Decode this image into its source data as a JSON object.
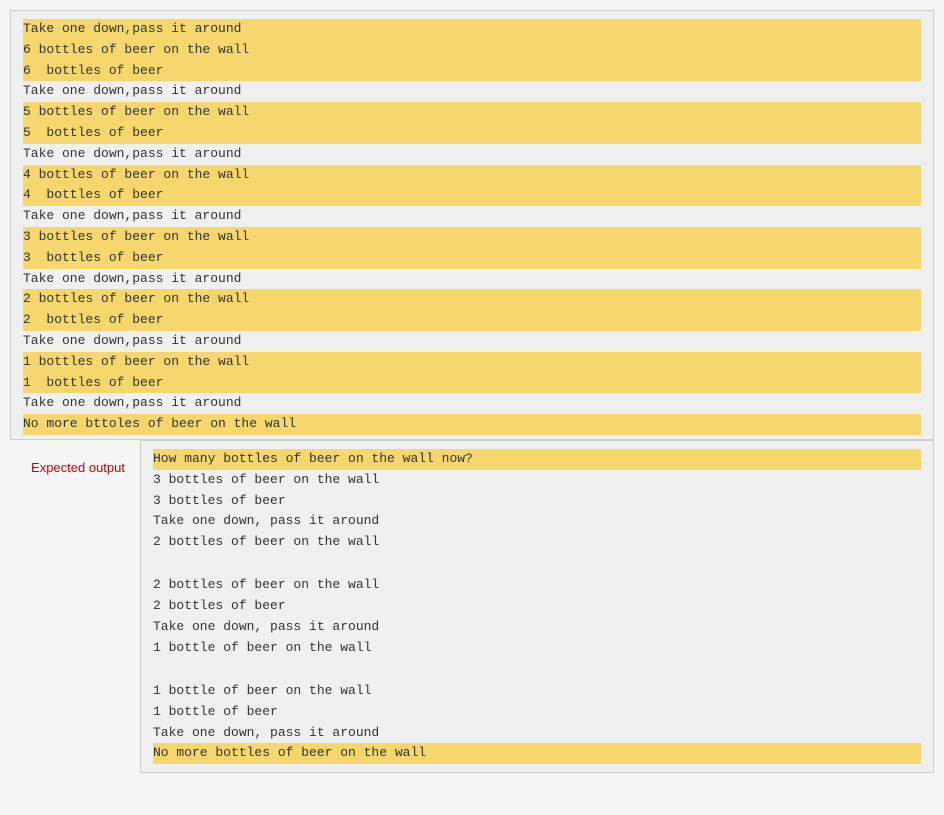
{
  "top_panel": {
    "lines": [
      {
        "text": "Take one down,pass it around",
        "highlight": true
      },
      {
        "text": "6 bottles of beer on the wall",
        "highlight": true
      },
      {
        "text": "6  bottles of beer",
        "highlight": true
      },
      {
        "text": "Take one down,pass it around",
        "highlight": false
      },
      {
        "text": "5 bottles of beer on the wall",
        "highlight": true
      },
      {
        "text": "5  bottles of beer",
        "highlight": true
      },
      {
        "text": "Take one down,pass it around",
        "highlight": false
      },
      {
        "text": "4 bottles of beer on the wall",
        "highlight": true
      },
      {
        "text": "4  bottles of beer",
        "highlight": true
      },
      {
        "text": "Take one down,pass it around",
        "highlight": false
      },
      {
        "text": "3 bottles of beer on the wall",
        "highlight": true
      },
      {
        "text": "3  bottles of beer",
        "highlight": true
      },
      {
        "text": "Take one down,pass it around",
        "highlight": false
      },
      {
        "text": "2 bottles of beer on the wall",
        "highlight": true
      },
      {
        "text": "2  bottles of beer",
        "highlight": true
      },
      {
        "text": "Take one down,pass it around",
        "highlight": false
      },
      {
        "text": "1 bottles of beer on the wall",
        "highlight": true
      },
      {
        "text": "1  bottles of beer",
        "highlight": true
      },
      {
        "text": "Take one down,pass it around",
        "highlight": false
      },
      {
        "text": "No more bttoles of beer on the wall",
        "highlight": true
      }
    ]
  },
  "label": "Expected output",
  "bottom_panel": {
    "lines": [
      {
        "text": "How many bottles of beer on the wall now?",
        "highlight": true,
        "empty_before": false
      },
      {
        "text": "3 bottles of beer on the wall",
        "highlight": false,
        "empty_before": false
      },
      {
        "text": "3 bottles of beer",
        "highlight": false,
        "empty_before": false
      },
      {
        "text": "Take one down, pass it around",
        "highlight": false,
        "empty_before": false
      },
      {
        "text": "2 bottles of beer on the wall",
        "highlight": false,
        "empty_before": false
      },
      {
        "text": "",
        "highlight": false,
        "empty_before": false,
        "is_empty": true
      },
      {
        "text": "2 bottles of beer on the wall",
        "highlight": false,
        "empty_before": false
      },
      {
        "text": "2 bottles of beer",
        "highlight": false,
        "empty_before": false
      },
      {
        "text": "Take one down, pass it around",
        "highlight": false,
        "empty_before": false
      },
      {
        "text": "1 bottle of beer on the wall",
        "highlight": false,
        "empty_before": false
      },
      {
        "text": "",
        "highlight": false,
        "empty_before": false,
        "is_empty": true
      },
      {
        "text": "1 bottle of beer on the wall",
        "highlight": false,
        "empty_before": false
      },
      {
        "text": "1 bottle of beer",
        "highlight": false,
        "empty_before": false
      },
      {
        "text": "Take one down, pass it around",
        "highlight": false,
        "empty_before": false
      },
      {
        "text": "No more bottles of beer on the wall",
        "highlight": true,
        "empty_before": false
      }
    ]
  }
}
